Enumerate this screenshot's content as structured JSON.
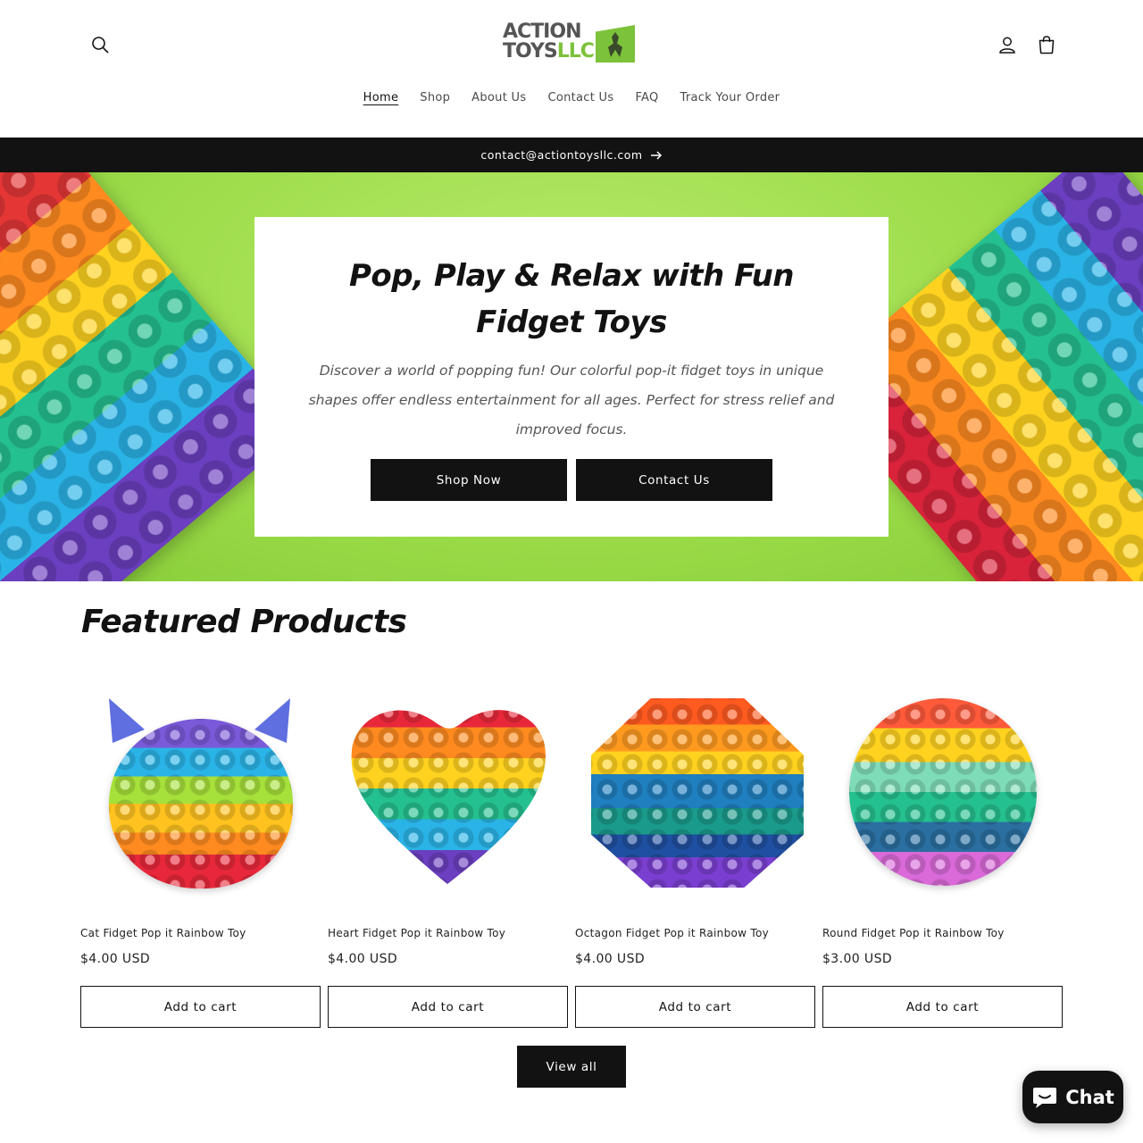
{
  "header": {
    "logo": {
      "line1": "ACTION",
      "line2_a": "TOYS",
      "line2_b": "LLC"
    },
    "nav": [
      "Home",
      "Shop",
      "About Us",
      "Contact Us",
      "FAQ",
      "Track Your Order"
    ],
    "active_nav": "Home",
    "icons": {
      "search": "search-icon",
      "account": "user-icon",
      "cart": "bag-icon"
    }
  },
  "announcement": {
    "text": "contact@actiontoysllc.com",
    "icon": "arrow-right-icon"
  },
  "hero": {
    "title": "Pop, Play & Relax with Fun Fidget Toys",
    "subtitle": "Discover a world of popping fun! Our colorful pop-it fidget toys in unique shapes offer endless entertainment for all ages. Perfect for stress relief and improved focus.",
    "buttons": [
      "Shop Now",
      "Contact Us"
    ]
  },
  "featured": {
    "title": "Featured Products",
    "products": [
      {
        "name": "Cat Fidget Pop it Rainbow Toy",
        "price": "$4.00 USD",
        "button": "Add to cart"
      },
      {
        "name": "Heart Fidget Pop it Rainbow Toy",
        "price": "$4.00 USD",
        "button": "Add to cart"
      },
      {
        "name": "Octagon Fidget Pop it Rainbow Toy",
        "price": "$4.00 USD",
        "button": "Add to cart"
      },
      {
        "name": "Round Fidget Pop it Rainbow Toy",
        "price": "$3.00 USD",
        "button": "Add to cart"
      }
    ],
    "view_all": "View all"
  },
  "chat": {
    "label": "Chat",
    "icon": "chat-bubble-icon"
  },
  "colors": {
    "primary": "#121212",
    "brand_green": "#7cc23a",
    "hero_bg": "#9ddc4a"
  }
}
